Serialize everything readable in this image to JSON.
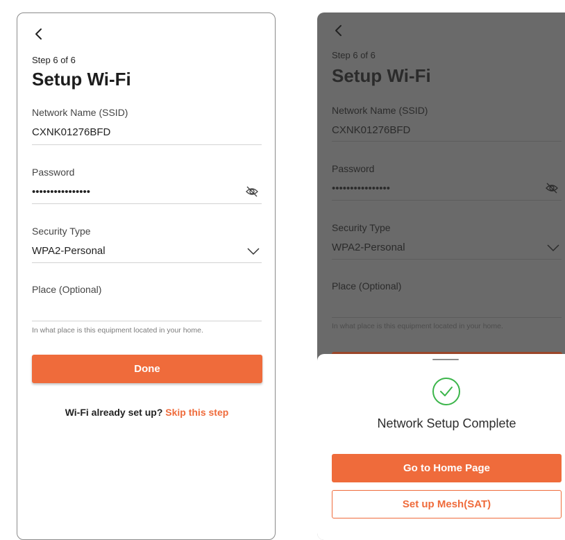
{
  "step_label": "Step 6 of 6",
  "title": "Setup Wi-Fi",
  "fields": {
    "ssid": {
      "label": "Network Name (SSID)",
      "value": "CXNK01276BFD"
    },
    "password": {
      "label": "Password",
      "value": "••••••••••••••••"
    },
    "security": {
      "label": "Security Type",
      "value": "WPA2-Personal"
    },
    "place": {
      "label": "Place (Optional)",
      "value": "",
      "hint": "In what place is this equipment located in your home."
    }
  },
  "done_label": "Done",
  "skip_prompt": "Wi-Fi already set up?",
  "skip_link": "Skip this step",
  "sheet": {
    "message": "Network Setup Complete",
    "primary_label": "Go to Home Page",
    "secondary_label": "Set up Mesh(SAT)"
  },
  "colors": {
    "accent": "#ef6b3b",
    "success": "#3bb54a",
    "overlay": "#6a6a6a"
  },
  "icons": {
    "back": "chevron-left-icon",
    "eye": "eye-off-icon",
    "dropdown": "chevron-down-icon",
    "success": "check-circle-icon"
  }
}
